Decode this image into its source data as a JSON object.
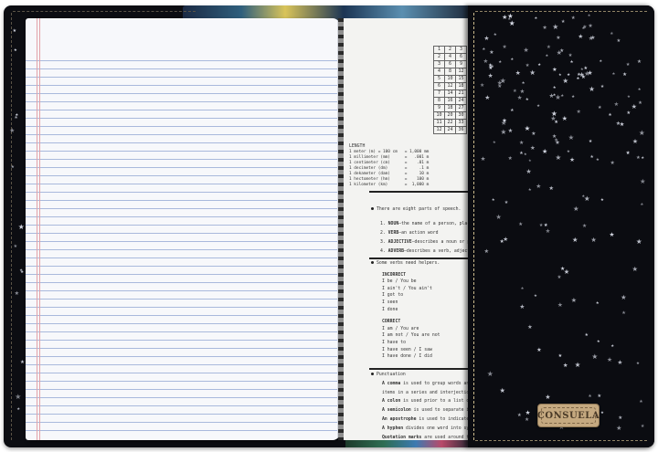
{
  "brand_tag": {
    "text": "CONSUELA"
  },
  "colors": {
    "cover": "#0c0d12",
    "page": "#f7f8fb",
    "rule_lines": "#a9b9dc",
    "margin_line": "#e2a2a8",
    "tag": "#c5a980",
    "stars": "#d7dbe6"
  },
  "reference_page": {
    "multiplication_table": [
      [
        "1",
        "2",
        "3"
      ],
      [
        "2",
        "4",
        "6"
      ],
      [
        "3",
        "6",
        "9"
      ],
      [
        "4",
        "8",
        "12"
      ],
      [
        "5",
        "10",
        "15"
      ],
      [
        "6",
        "12",
        "18"
      ],
      [
        "7",
        "14",
        "21"
      ],
      [
        "8",
        "16",
        "24"
      ],
      [
        "9",
        "18",
        "27"
      ],
      [
        "10",
        "20",
        "30"
      ],
      [
        "11",
        "22",
        "33"
      ],
      [
        "12",
        "24",
        "36"
      ]
    ],
    "length": {
      "title": "LENGTH",
      "rows": [
        "1 meter (m) = 100 cm   = 1,000 mm",
        "1 millimeter (mm)      =   .001 m",
        "1 centimeter (cm)      =    .01 m",
        "1 decimeter (dm)       =     .1 m",
        "1 dekameter (dam)      =     10 m",
        "1 hectometer (hm)      =    100 m",
        "1 kilometer (km)       =  1,000 m"
      ]
    },
    "speech": {
      "intro": "There are eight parts of speech.",
      "items": [
        {
          "num": "1.",
          "term": "NOUN",
          "desc": "—the name of a person, place, or"
        },
        {
          "num": "2.",
          "term": "VERB",
          "desc": "—an action word"
        },
        {
          "num": "3.",
          "term": "ADJECTIVE",
          "desc": "—describes a noun or pronou"
        },
        {
          "num": "4.",
          "term": "ADVERB",
          "desc": "—describes a verb, adjective, or"
        }
      ]
    },
    "verbs": {
      "intro": "Some verbs need helpers.",
      "incorrect_title": "INCORRECT",
      "incorrect": [
        "I be / You be",
        "I ain't / You ain't",
        "I got to",
        "I seen",
        "I done"
      ],
      "correct_title": "CORRECT",
      "correct": [
        "I am / You are",
        "I am not / You are not",
        "I have to",
        "I have seen / I saw",
        "I have done / I did"
      ]
    },
    "punctuation": {
      "title": "Punctuation",
      "lines": [
        {
          "bold": "A comma",
          "rest": " is used to group words and phr"
        },
        {
          "bold": "",
          "rest": "items in a series and interjections."
        },
        {
          "bold": "A colon",
          "rest": " is used prior to a list or other ele"
        },
        {
          "bold": "A semicolon",
          "rest": " is used to separate indepen"
        },
        {
          "bold": "An apostrophe",
          "rest": " is used to indicate the po"
        },
        {
          "bold": "A hyphen",
          "rest": " divides one word into syllables"
        },
        {
          "bold": "Quotation marks",
          "rest": " are used around the exa"
        },
        {
          "bold": "",
          "rest": "titles, short plays, episodes of television"
        },
        {
          "bold": "Italics",
          "rest": " are used with the titles of books,"
        },
        {
          "bold": "",
          "rest": "(In handwriting, use underlining.)"
        }
      ]
    }
  }
}
